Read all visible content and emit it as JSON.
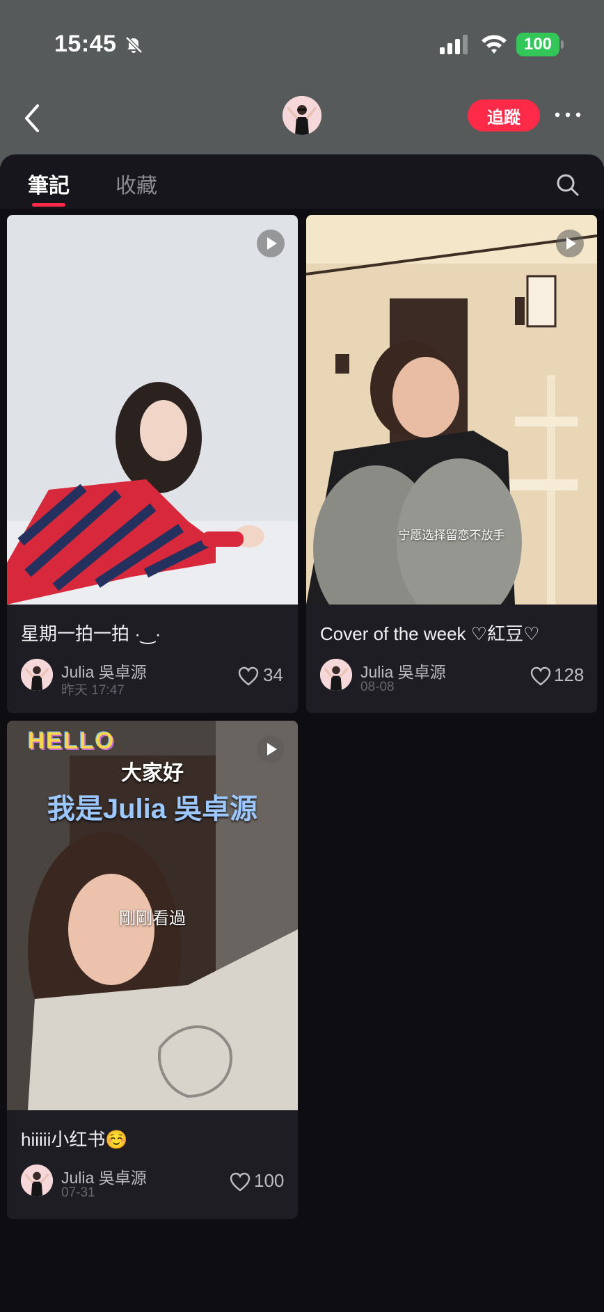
{
  "status_bar": {
    "time": "15:45",
    "battery": "100",
    "icons": [
      "bell-slash-icon",
      "cellular-signal-icon",
      "wifi-icon",
      "battery-icon"
    ]
  },
  "nav": {
    "back_icon": "chevron-left-icon",
    "follow_label": "追蹤",
    "more_icon": "more-horizontal-icon"
  },
  "tabs": {
    "items": [
      {
        "label": "筆記",
        "active": true
      },
      {
        "label": "收藏",
        "active": false
      }
    ],
    "search_icon": "search-icon"
  },
  "colors": {
    "accent": "#ff2a47",
    "background": "#0e0e12",
    "card": "#1d1d23",
    "header": "#565a5b",
    "battery": "#33c659"
  },
  "notes": [
    {
      "title": "星期一拍一拍 ·‿·",
      "author": "Julia 吳卓源",
      "date": "昨天 17:47",
      "likes": "34",
      "is_video": true
    },
    {
      "title": "Cover of the week ♡紅豆♡",
      "author": "Julia 吳卓源",
      "date": "08-08",
      "likes": "128",
      "is_video": true,
      "caption": "宁愿选择留恋不放手"
    },
    {
      "title": "hiiiii小红书☺️",
      "author": "Julia 吳卓源",
      "date": "07-31",
      "likes": "100",
      "is_video": true,
      "overlay_hello": "HELLO",
      "overlay_line1": "大家好",
      "overlay_line2": "我是Julia 吳卓源",
      "badge": "剛剛看過"
    }
  ]
}
